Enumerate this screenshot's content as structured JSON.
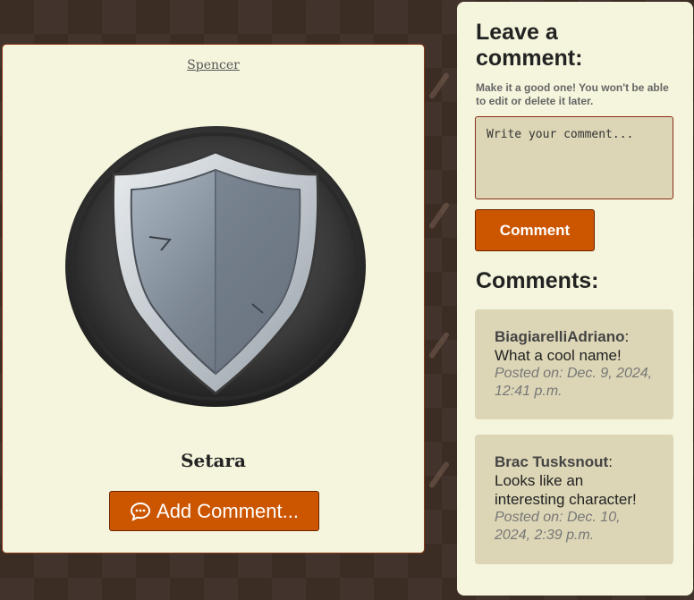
{
  "character": {
    "owner": "Spencer",
    "name": "Setara",
    "portrait_icon": "shield-icon",
    "add_comment_label": "Add Comment...",
    "add_comment_icon": "comment-dots-icon"
  },
  "sidebar": {
    "title": "Leave a comment:",
    "hint": "Make it a good one! You won't be able to edit or delete it later.",
    "textarea_placeholder": "Write your comment...",
    "comment_button": "Comment",
    "comments_title": "Comments:",
    "comments": [
      {
        "author": "BiagiarelliAdriano",
        "text": "What a cool name!",
        "posted": "Posted on: Dec. 9, 2024, 12:41 p.m."
      },
      {
        "author": "Brac Tusksnout",
        "text": "Looks like an interesting character!",
        "posted": "Posted on: Dec. 10, 2024, 2:39 p.m."
      }
    ]
  },
  "colors": {
    "background": "#3b2c24",
    "card": "#f5f4dc",
    "accent": "#cc5500",
    "comment_bg": "#dcd6b6"
  }
}
